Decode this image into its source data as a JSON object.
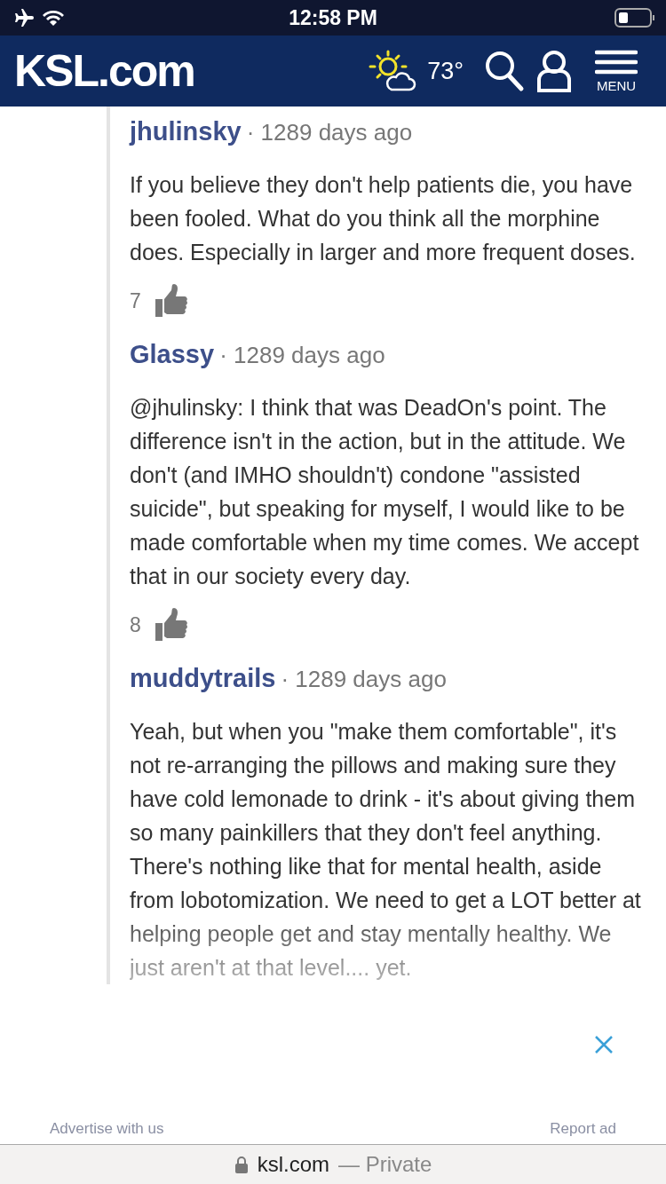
{
  "status_bar": {
    "time": "12:58 PM"
  },
  "header": {
    "logo": "KSL.com",
    "temperature": "73°",
    "menu_label": "MENU"
  },
  "comments": [
    {
      "author": "jhulinsky",
      "age": "· 1289 days ago",
      "body": "If you believe they don't help patients die, you have been fooled. What do you think all the morphine does. Especially in larger and more frequent doses.",
      "likes": "7",
      "faded": false
    },
    {
      "author": "Glassy",
      "age": "· 1289 days ago",
      "body": "@jhulinsky: I think that was DeadOn's point. The difference isn't in the action, but in the attitude. We don't (and IMHO shouldn't) condone \"assisted suicide\", but speaking for myself, I would like to be made comfortable when my time comes. We accept that in our society every day.",
      "likes": "8",
      "faded": false
    },
    {
      "author": "muddytrails",
      "age": "· 1289 days ago",
      "body": "Yeah, but when you \"make them comfortable\", it's not re-arranging the pillows and making sure they have cold lemonade to drink - it's about giving them so many painkillers that they don't feel anything. There's nothing like that for mental health, aside from lobotomization. We need to get a LOT better at helping people get and stay mentally healthy. We just aren't at that level.... yet.",
      "faded": true
    }
  ],
  "ad_bar": {
    "advertise": "Advertise with us",
    "report": "Report ad"
  },
  "browser_bar": {
    "domain": "ksl.com",
    "mode": "— Private"
  }
}
